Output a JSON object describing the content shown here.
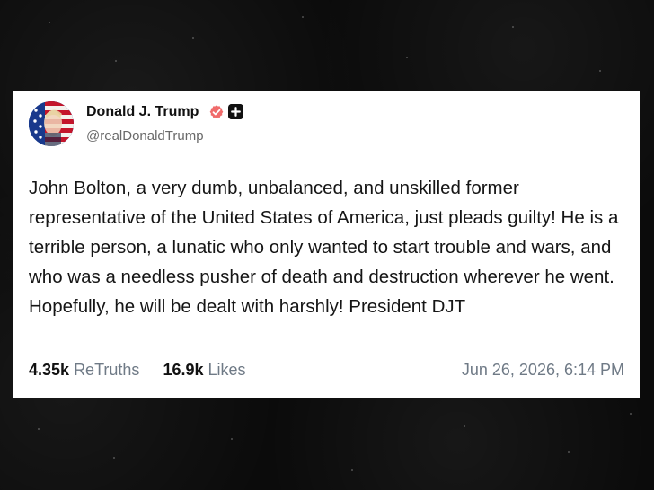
{
  "post": {
    "author": {
      "display_name": "Donald J. Trump",
      "handle": "@realDonaldTrump",
      "avatar_icon": "american-flag-avatar-icon",
      "verified_icon": "verified-check-icon",
      "badge_icon": "plus-badge-icon",
      "verified_color": "#f06b6b"
    },
    "text": "John Bolton, a very dumb, unbalanced, and unskilled former representative of the United States of America, just pleads guilty! He is a terrible person, a lunatic who only wanted to start trouble and wars, and who was a needless pusher of death and destruction wherever he went. Hopefully, he will be dealt with harshly! President DJT",
    "stats": {
      "retruths_count": "4.35k",
      "retruths_label": "ReTruths",
      "likes_count": "16.9k",
      "likes_label": "Likes"
    },
    "timestamp": "Jun 26, 2026, 6:14 PM"
  }
}
